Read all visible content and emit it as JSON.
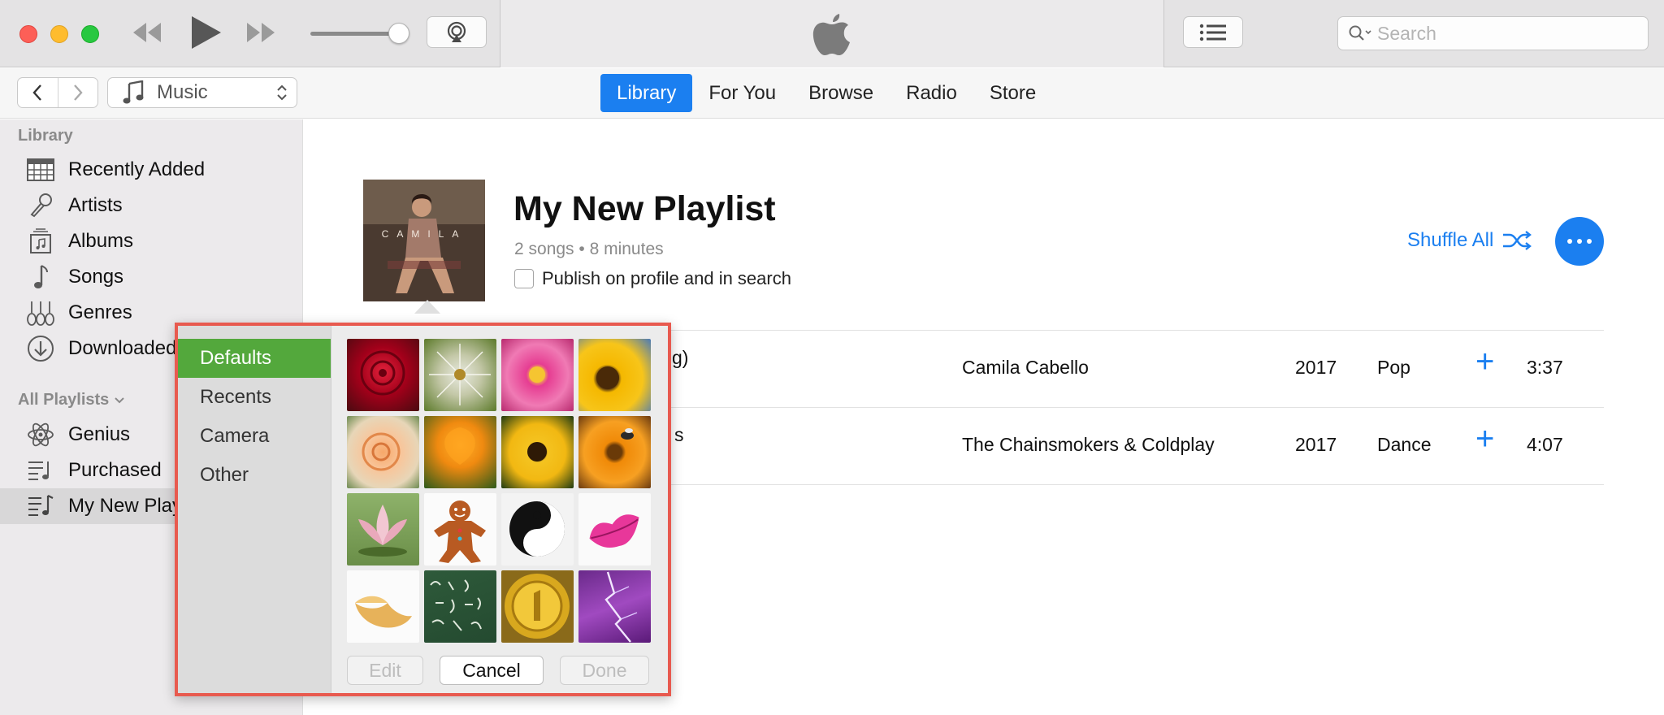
{
  "window": {
    "traffic_lights": {
      "close": "#fd5f57",
      "minimize": "#febc2e",
      "zoom": "#28c840"
    }
  },
  "toolbar": {
    "volume_fraction": 0.82,
    "search_placeholder": "Search"
  },
  "nav": {
    "media_kind": "Music",
    "tabs": [
      {
        "label": "Library",
        "active": true
      },
      {
        "label": "For You",
        "active": false
      },
      {
        "label": "Browse",
        "active": false
      },
      {
        "label": "Radio",
        "active": false
      },
      {
        "label": "Store",
        "active": false
      }
    ],
    "accent": "#1b7ff0"
  },
  "sidebar": {
    "library_heading": "Library",
    "library_items": [
      {
        "label": "Recently Added",
        "icon": "calendar-grid-icon"
      },
      {
        "label": "Artists",
        "icon": "microphone-icon"
      },
      {
        "label": "Albums",
        "icon": "album-stack-icon"
      },
      {
        "label": "Songs",
        "icon": "music-note-icon"
      },
      {
        "label": "Genres",
        "icon": "guitars-icon"
      },
      {
        "label": "Downloaded",
        "icon": "download-circle-icon"
      }
    ],
    "playlists_heading": "All Playlists",
    "playlist_items": [
      {
        "label": "Genius",
        "icon": "atom-icon"
      },
      {
        "label": "Purchased",
        "icon": "playlist-icon"
      },
      {
        "label": "My New Playlist",
        "icon": "playlist-note-icon",
        "selected": true
      }
    ]
  },
  "playlist": {
    "cover_text": "CAMILA",
    "title": "My New Playlist",
    "meta": "2 songs • 8 minutes",
    "publish_label": "Publish on profile and in search",
    "shuffle_label": "Shuffle All",
    "tracks": [
      {
        "title_visible": "g)",
        "artist": "Camila Cabello",
        "year": "2017",
        "genre": "Pop",
        "duration": "3:37"
      },
      {
        "title_visible": "s",
        "artist": "The Chainsmokers & Coldplay",
        "year": "2017",
        "genre": "Dance",
        "duration": "4:07"
      }
    ]
  },
  "picker": {
    "categories": [
      {
        "label": "Defaults",
        "active": true
      },
      {
        "label": "Recents",
        "active": false
      },
      {
        "label": "Camera",
        "active": false
      },
      {
        "label": "Other",
        "active": false
      }
    ],
    "active_color": "#53a83c",
    "tiles": [
      "red-rose",
      "dandelion",
      "pink-daisy",
      "sunflower",
      "peach-rose",
      "orange-poppy",
      "black-eyed-susan",
      "orange-gerbera",
      "lotus",
      "gingerbread-man",
      "yin-yang",
      "lips",
      "fortune-cookie",
      "chalkboard",
      "gold-medal",
      "lightning"
    ],
    "buttons": {
      "edit": "Edit",
      "cancel": "Cancel",
      "done": "Done"
    }
  }
}
